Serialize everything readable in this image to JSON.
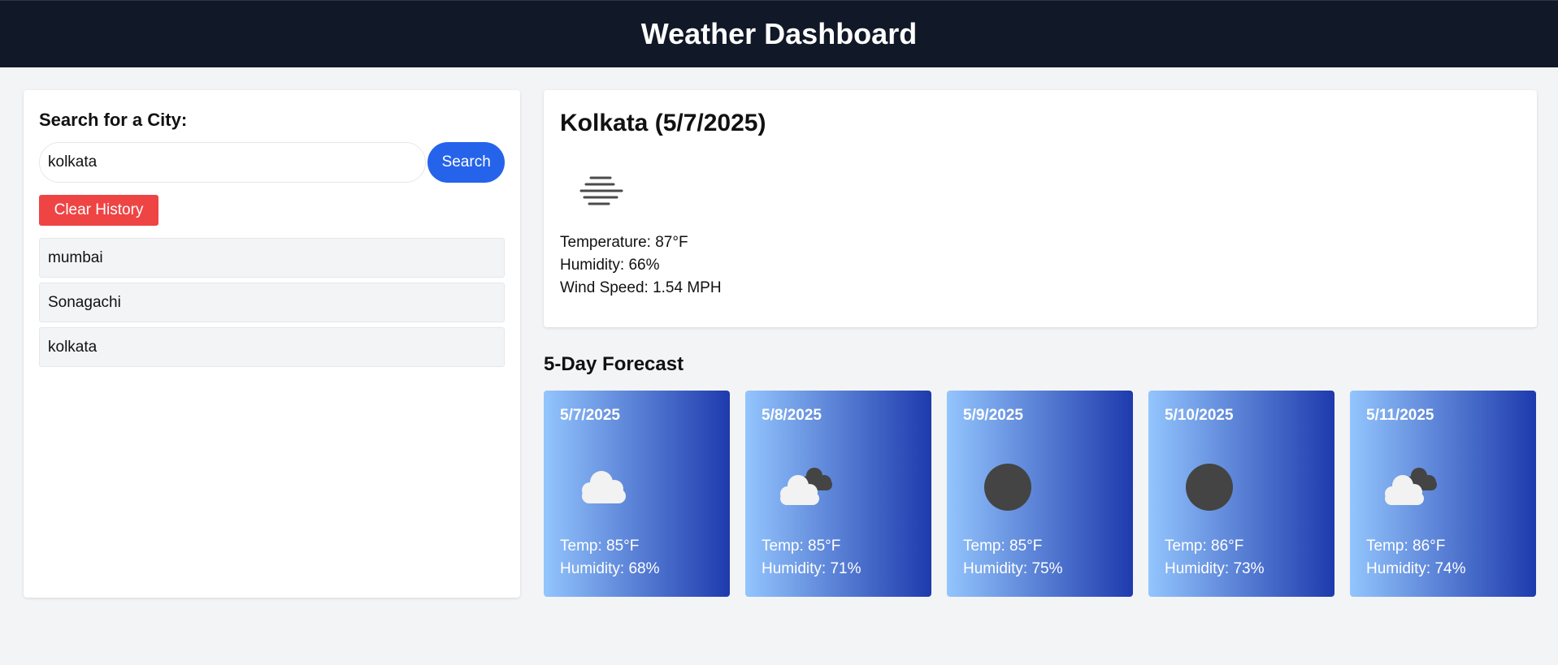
{
  "header": {
    "title": "Weather Dashboard"
  },
  "search": {
    "label": "Search for a City:",
    "value": "kolkata",
    "button_label": "Search",
    "clear_label": "Clear History"
  },
  "history": [
    "mumbai",
    "Sonagachi",
    "kolkata"
  ],
  "current": {
    "title": "Kolkata (5/7/2025)",
    "icon": "mist-icon",
    "temperature": "Temperature: 87°F",
    "humidity": "Humidity: 66%",
    "wind": "Wind Speed: 1.54 MPH"
  },
  "forecast": {
    "title": "5-Day Forecast",
    "days": [
      {
        "date": "5/7/2025",
        "icon": "cloud-icon",
        "temp": "Temp: 85°F",
        "humidity": "Humidity: 68%"
      },
      {
        "date": "5/8/2025",
        "icon": "broken-clouds-icon",
        "temp": "Temp: 85°F",
        "humidity": "Humidity: 71%"
      },
      {
        "date": "5/9/2025",
        "icon": "overcast-icon",
        "temp": "Temp: 85°F",
        "humidity": "Humidity: 75%"
      },
      {
        "date": "5/10/2025",
        "icon": "overcast-icon",
        "temp": "Temp: 86°F",
        "humidity": "Humidity: 73%"
      },
      {
        "date": "5/11/2025",
        "icon": "broken-clouds-icon",
        "temp": "Temp: 86°F",
        "humidity": "Humidity: 74%"
      }
    ]
  },
  "colors": {
    "header_bg": "#111827",
    "search_button": "#2563eb",
    "clear_button": "#ef4444",
    "card_gradient_start": "#93c5fd",
    "card_gradient_end": "#1e3aad"
  }
}
